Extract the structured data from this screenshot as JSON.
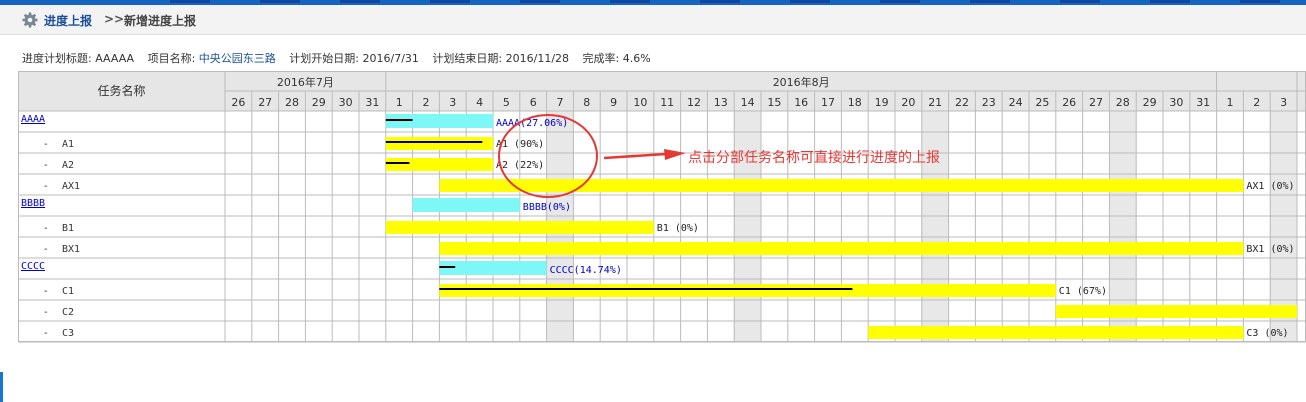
{
  "header": {
    "crumb_current": "进度上报",
    "separator": ">>",
    "crumb_page": "新增进度上报"
  },
  "info": {
    "title_label": "进度计划标题:",
    "title_value": "AAAAA",
    "project_label": "项目名称:",
    "project_value": "中央公园东三路",
    "start_label": "计划开始日期:",
    "start_value": "2016/7/31",
    "end_label": "计划结束日期:",
    "end_value": "2016/11/28",
    "rate_label": "完成率:",
    "rate_value": "4.6%"
  },
  "table": {
    "task_header": "任务名称",
    "months": [
      {
        "label": "2016年7月",
        "days": 6
      },
      {
        "label": "2016年8月",
        "days": 31
      },
      {
        "label": "",
        "days": 3
      }
    ],
    "days": [
      "26",
      "27",
      "28",
      "29",
      "30",
      "31",
      "1",
      "2",
      "3",
      "4",
      "5",
      "6",
      "7",
      "8",
      "9",
      "10",
      "11",
      "12",
      "13",
      "14",
      "15",
      "16",
      "17",
      "18",
      "19",
      "20",
      "21",
      "22",
      "23",
      "24",
      "25",
      "26",
      "27",
      "28",
      "29",
      "30",
      "31",
      "1",
      "2",
      "3"
    ],
    "shaded_days": [
      12,
      19,
      26,
      33,
      39
    ]
  },
  "tasks": [
    {
      "name": "AAAA",
      "indent": false,
      "link": true,
      "start": 6,
      "end": 10,
      "progress": 1,
      "bar_color": "#7ef7f7",
      "label": "AAAA(27.06%)",
      "label_link": true
    },
    {
      "name": "A1",
      "indent": true,
      "link": false,
      "start": 6,
      "end": 10,
      "progress": 3.6,
      "bar_color": "#ffff00",
      "label": "A1 (90%)",
      "label_link": false
    },
    {
      "name": "A2",
      "indent": true,
      "link": false,
      "start": 6,
      "end": 10,
      "progress": 0.88,
      "bar_color": "#ffff00",
      "label": "A2 (22%)",
      "label_link": false
    },
    {
      "name": "AX1",
      "indent": true,
      "link": false,
      "start": 8,
      "end": 38,
      "progress": 0,
      "bar_color": "#ffff00",
      "label": "AX1 (0%)",
      "label_link": false
    },
    {
      "name": "BBBB",
      "indent": false,
      "link": true,
      "start": 7,
      "end": 11,
      "progress": 0,
      "bar_color": "#7ef7f7",
      "label": "BBBB(0%)",
      "label_link": true
    },
    {
      "name": "B1",
      "indent": true,
      "link": false,
      "start": 6,
      "end": 16,
      "progress": 0,
      "bar_color": "#ffff00",
      "label": "B1 (0%)",
      "label_link": false
    },
    {
      "name": "BX1",
      "indent": true,
      "link": false,
      "start": 8,
      "end": 38,
      "progress": 0,
      "bar_color": "#ffff00",
      "label": "BX1 (0%)",
      "label_link": false
    },
    {
      "name": "CCCC",
      "indent": false,
      "link": true,
      "start": 8,
      "end": 12,
      "progress": 0.59,
      "bar_color": "#7ef7f7",
      "label": "CCCC(14.74%)",
      "label_link": true
    },
    {
      "name": "C1",
      "indent": true,
      "link": false,
      "start": 8,
      "end": 31,
      "progress": 15.41,
      "bar_color": "#ffff00",
      "label": "C1 (67%)",
      "label_link": false
    },
    {
      "name": "C2",
      "indent": true,
      "link": false,
      "start": 31,
      "end": 40,
      "progress": 0,
      "bar_color": "#ffff00",
      "label": "",
      "label_link": false
    },
    {
      "name": "C3",
      "indent": true,
      "link": false,
      "start": 24,
      "end": 38,
      "progress": 0,
      "bar_color": "#ffff00",
      "label": "C3 (0%)",
      "label_link": false
    }
  ],
  "annotation": {
    "text": "点击分部任务名称可直接进行进度的上报",
    "color": "#e53935"
  },
  "colors": {
    "header_bg": "#e6e6e6",
    "border": "#bbbbbb",
    "shade": "#e8e8e8",
    "link": "#0000cc",
    "progress": "#000000"
  }
}
